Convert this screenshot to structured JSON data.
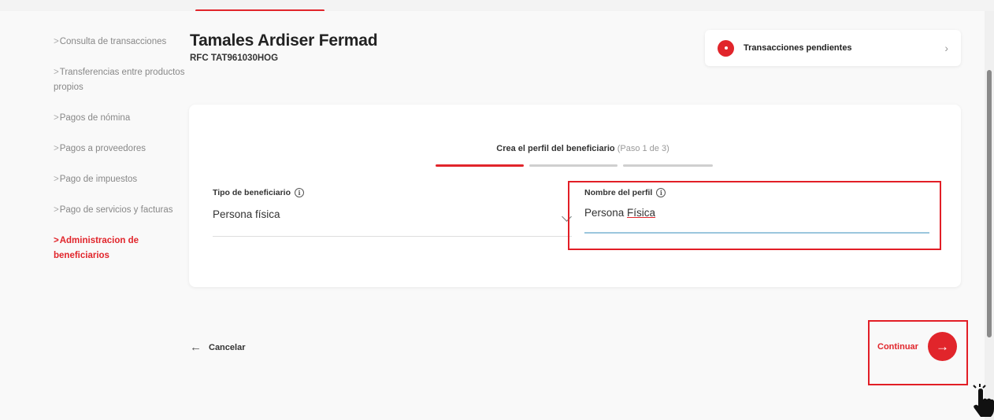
{
  "sidebar": {
    "items": [
      {
        "label": "Consulta de transacciones",
        "active": false
      },
      {
        "label": "Transferencias entre productos propios",
        "active": false
      },
      {
        "label": "Pagos de nómina",
        "active": false
      },
      {
        "label": "Pagos a proveedores",
        "active": false
      },
      {
        "label": "Pago de impuestos",
        "active": false
      },
      {
        "label": "Pago de servicios y facturas",
        "active": false
      },
      {
        "label": "Administracion de beneficiarios",
        "active": true
      }
    ]
  },
  "header": {
    "company_name": "Tamales Ardiser Fermad",
    "rfc": "RFC TAT961030HOG"
  },
  "pending": {
    "label": "Transacciones pendientes",
    "arrow": "›"
  },
  "stepper": {
    "title": "Crea el perfil del beneficiario",
    "step_text": "(Paso 1 de 3)",
    "current_step": 1,
    "total_steps": 3
  },
  "form": {
    "tipo_label": "Tipo de beneficiario",
    "tipo_value": "Persona física",
    "nombre_label": "Nombre del perfil",
    "nombre_value_part1": "Persona ",
    "nombre_value_part2": "Física"
  },
  "actions": {
    "cancel_label": "Cancelar",
    "cancel_icon": "←",
    "continue_label": "Continuar",
    "continue_icon": "→"
  },
  "colors": {
    "accent": "#e1252b",
    "highlight": "#e21e26",
    "input_focus": "#9bc6dd"
  }
}
